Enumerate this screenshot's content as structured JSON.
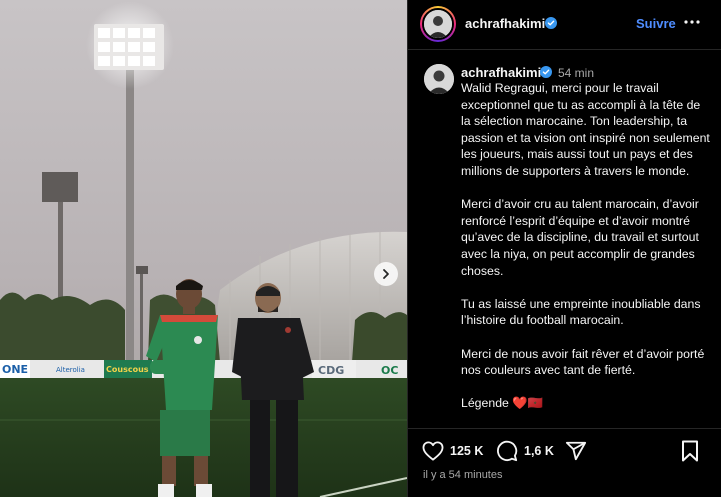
{
  "header": {
    "username": "achrafhakimi",
    "follow_label": "Suivre",
    "more_icon": "more-horizontal-icon"
  },
  "post": {
    "author": "achrafhakimi",
    "time": "54 min",
    "caption": [
      "Walid Regragui, merci pour le travail exceptionnel que tu as accompli à la tête de la sélection marocaine. Ton leadership, ta passion et ta vision ont inspiré non seulement les joueurs, mais aussi tout un pays et des millions de supporters à travers le monde.",
      "Merci d’avoir cru au talent marocain, d’avoir renforcé l’esprit d’équipe et d’avoir montré qu’avec de la discipline, du travail et surtout avec la niya, on peut accomplir de grandes choses.",
      "Tu as laissé une empreinte inoubliable dans l’histoire du football marocain.",
      "Merci de nous avoir fait rêver et d’avoir porté nos couleurs avec tant de fierté.",
      "Légende ❤️🇲🇦"
    ]
  },
  "actions": {
    "likes": "125 K",
    "comments": "1,6 K",
    "posted_ago": "il y a 54 minutes"
  },
  "photo": {
    "boards": [
      "ONE",
      "Alterolia",
      "Couscous",
      "CDG",
      "OC"
    ]
  },
  "colors": {
    "accent": "#4f8dff",
    "verified": "#3897f0",
    "background": "#000000",
    "muted": "#a8a8a8"
  }
}
